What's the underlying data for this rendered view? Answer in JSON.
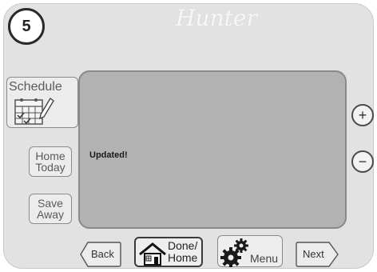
{
  "header": {
    "step_number": "5",
    "brand": "Hunter"
  },
  "screen": {
    "message": "Updated!"
  },
  "sidebar": {
    "schedule_label": "Schedule",
    "home_today_line1": "Home",
    "home_today_line2": "Today",
    "save_away_line1": "Save",
    "save_away_line2": "Away"
  },
  "controls": {
    "plus_label": "+",
    "minus_label": "−"
  },
  "bottom_nav": {
    "back_label": "Back",
    "done_home_line1": "Done/",
    "done_home_line2": "Home",
    "menu_label": "Menu",
    "next_label": "Next"
  },
  "icons": [
    "calendar-icon",
    "house-icon",
    "gear-icon"
  ]
}
